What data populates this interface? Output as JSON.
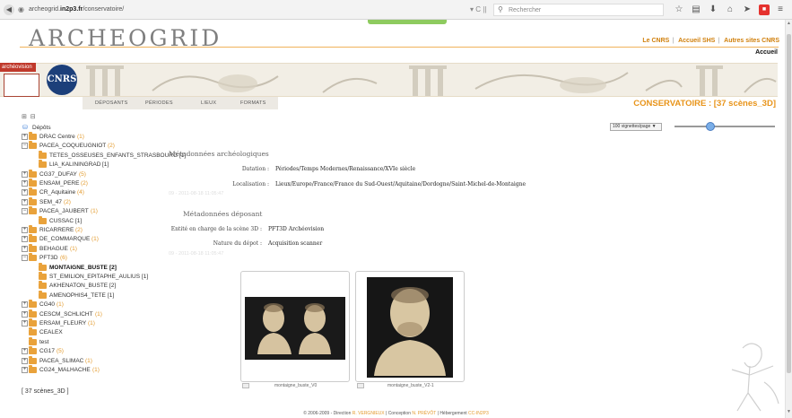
{
  "browser": {
    "url_prefix": "archeogrid.",
    "url_domain": "in2p3.fr",
    "url_path": "/conservatoire/",
    "search_placeholder": "Rechercher"
  },
  "header": {
    "logo": "ARCHEOGRID",
    "links": [
      "Le CNRS",
      "Accueil SHS",
      "Autres sites CNRS"
    ],
    "home": "Accueil",
    "archeovision": "archéovision",
    "cnrs": "CNRS"
  },
  "nav": {
    "tabs": [
      "Déposants",
      "Périodes",
      "Lieux",
      "Formats"
    ],
    "title": "CONSERVATOIRE : [37 scènes_3D]"
  },
  "tree": {
    "toggle": "⊞ ⊟",
    "root": "Dépôts",
    "items": [
      {
        "label": "DRAC Centre",
        "count": "(1)",
        "pm": "+",
        "depth": 0
      },
      {
        "label": "PACEA_COQUEUGNIOT",
        "count": "(2)",
        "pm": "−",
        "depth": 0
      },
      {
        "label": "TETES_OSSEUSES_ENFANTS_STRASBOURG",
        "count": "[1]",
        "pm": "",
        "depth": 1
      },
      {
        "label": "LIA_KALININGRAD",
        "count": "[1]",
        "pm": "",
        "depth": 1
      },
      {
        "label": "CG37_DUFAY",
        "count": "(5)",
        "pm": "+",
        "depth": 0
      },
      {
        "label": "ENSAM_PERE",
        "count": "(2)",
        "pm": "+",
        "depth": 0
      },
      {
        "label": "CR_Aquitaine",
        "count": "(4)",
        "pm": "+",
        "depth": 0
      },
      {
        "label": "SEM_47",
        "count": "(2)",
        "pm": "+",
        "depth": 0
      },
      {
        "label": "PACEA_JAUBERT",
        "count": "(1)",
        "pm": "−",
        "depth": 0
      },
      {
        "label": "CUSSAC",
        "count": "[1]",
        "pm": "",
        "depth": 1
      },
      {
        "label": "RICARRERE",
        "count": "(2)",
        "pm": "+",
        "depth": 0
      },
      {
        "label": "DE_COMMARQUE",
        "count": "(1)",
        "pm": "+",
        "depth": 0
      },
      {
        "label": "BEHAGUE",
        "count": "(1)",
        "pm": "+",
        "depth": 0
      },
      {
        "label": "PFT3D",
        "count": "(6)",
        "pm": "−",
        "depth": 0
      },
      {
        "label": "MONTAIGNE_BUSTE",
        "count": "[2]",
        "pm": "",
        "depth": 1,
        "bold": true
      },
      {
        "label": "ST_EMILION_EPITAPHE_AULIUS",
        "count": "[1]",
        "pm": "",
        "depth": 1
      },
      {
        "label": "AKHENATON_BUSTE",
        "count": "[2]",
        "pm": "",
        "depth": 1
      },
      {
        "label": "AMENOPHIS4_TETE",
        "count": "[1]",
        "pm": "",
        "depth": 1
      },
      {
        "label": "CG40",
        "count": "(1)",
        "pm": "+",
        "depth": 0
      },
      {
        "label": "CESCM_SCHLICHT",
        "count": "(1)",
        "pm": "+",
        "depth": 0
      },
      {
        "label": "ERSAM_FLEURY",
        "count": "(1)",
        "pm": "+",
        "depth": 0
      },
      {
        "label": "CEALEX",
        "count": "",
        "pm": "",
        "depth": 0
      },
      {
        "label": "test",
        "count": "",
        "pm": "",
        "depth": 0
      },
      {
        "label": "CG17",
        "count": "(5)",
        "pm": "+",
        "depth": 0
      },
      {
        "label": "PACEA_SLIMAC",
        "count": "(1)",
        "pm": "+",
        "depth": 0
      },
      {
        "label": "CG24_MALHACHE",
        "count": "(1)",
        "pm": "+",
        "depth": 0
      }
    ],
    "status": "[ 37 scènes_3D ]"
  },
  "meta": {
    "arch_title": "Métadonnées archéologiques",
    "datation_label": "Datation :",
    "datation_value": "Périodes/Temps Modernes/Renaissance/XVIe siècle",
    "localisation_label": "Localisation :",
    "localisation_value": "Lieux/Europe/France/France du Sud-Ouest/Aquitaine/Dordogne/Saint-Michel-de-Montaigne",
    "faded1": "09 - 2011-08-18 11:05:47",
    "dep_title": "Métadonnées déposant",
    "entite_label": "Entité en charge de la scène 3D :",
    "entite_value": "PFT3D Archéovision",
    "nature_label": "Nature du dépot :",
    "nature_value": "Acquisition scanner",
    "faded2": "09 - 2011-08-18 11:05:47"
  },
  "controls": {
    "per_page": "100 vignettes/page ▼",
    "slider_value": 0.36
  },
  "thumbs": [
    {
      "caption": "montaigne_buste_V0"
    },
    {
      "caption": "montaigne_buste_V2-1"
    }
  ],
  "footer": {
    "pre": "© 2006-2009 - Direction",
    "n1": "R. VERGNIEUX",
    "mid1": "| Conception",
    "n2": "N. PRÉVÔT",
    "mid2": "| Hébergement",
    "n3": "CC-IN2P3"
  }
}
